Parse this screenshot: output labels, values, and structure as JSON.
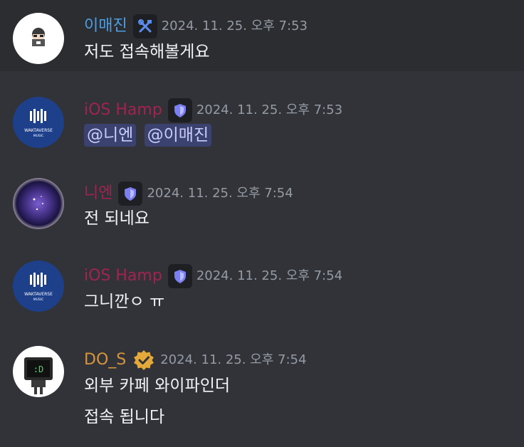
{
  "colors": {
    "background": "#313338",
    "highlight_row": "#2b2d31",
    "blue_name": "#4e9ee4",
    "pink_name": "#a2244e",
    "gold_name": "#d6963b",
    "timestamp": "#949ba4",
    "mention_bg": "#3c4270",
    "mention_text": "#c9cdfb"
  },
  "messages": [
    {
      "username": "이매진",
      "badge_icon": "hammer-wrench-icon",
      "timestamp": "2024. 11. 25. 오후 7:53",
      "lines": [
        "저도 접속해볼게요"
      ]
    },
    {
      "username": "iOS Hamp",
      "badge_icon": "shield-icon",
      "timestamp": "2024. 11. 25. 오후 7:53",
      "mentions": [
        "@니엔",
        "@이매진"
      ]
    },
    {
      "username": "니엔",
      "badge_icon": "shield-icon",
      "timestamp": "2024. 11. 25. 오후 7:54",
      "lines": [
        "전 되네요"
      ]
    },
    {
      "username": "iOS Hamp",
      "badge_icon": "shield-icon",
      "timestamp": "2024. 11. 25. 오후 7:54",
      "lines": [
        "그니깐ㅇ ㅠ"
      ]
    },
    {
      "username": "DO_S",
      "badge_icon": "verified-check-icon",
      "timestamp": "2024. 11. 25. 오후 7:54",
      "lines": [
        "외부 카페 와이파인더",
        "접속 됩니다"
      ]
    }
  ],
  "avatars": {
    "wakta_text_1": "WAKTAVERSE",
    "wakta_text_2": "MUSIC",
    "terminal_text": ":D"
  }
}
